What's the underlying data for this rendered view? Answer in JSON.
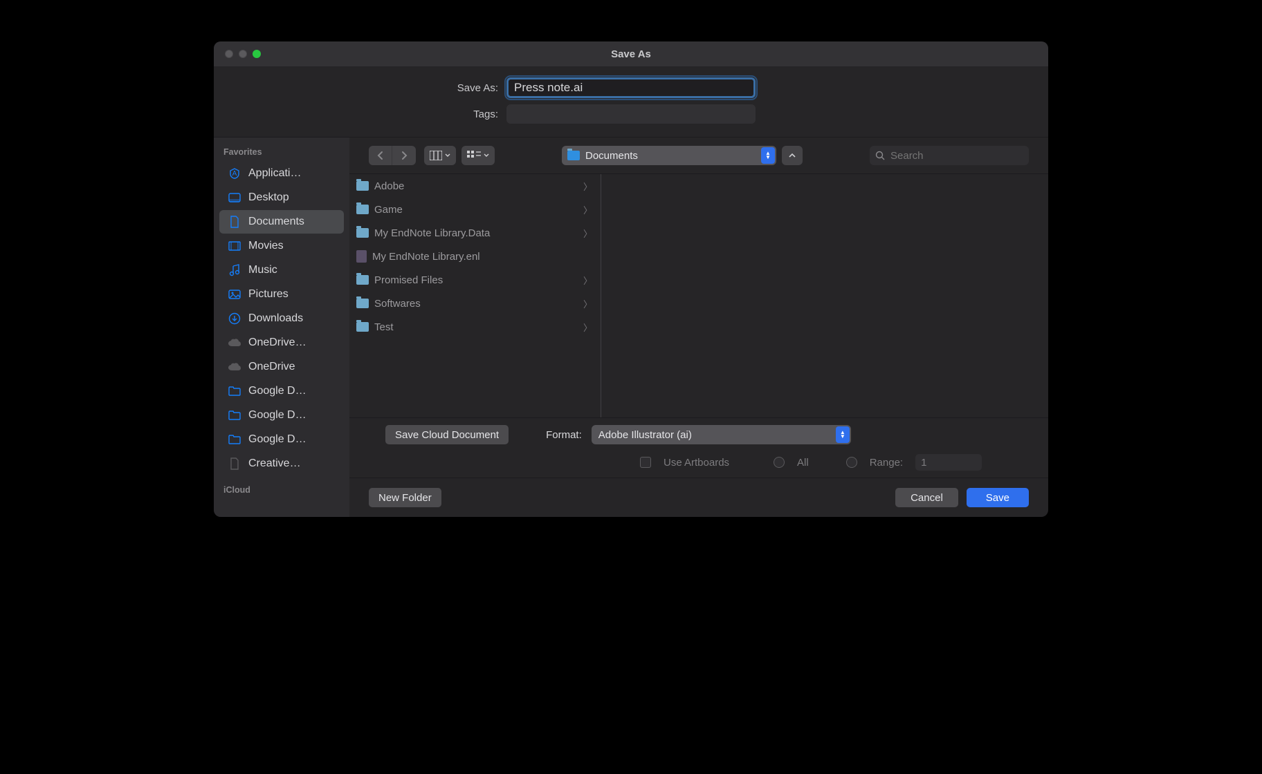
{
  "window": {
    "title": "Save As"
  },
  "form": {
    "saveas_label": "Save As:",
    "saveas_value": "Press note.ai",
    "tags_label": "Tags:",
    "tags_value": ""
  },
  "location": {
    "folder_label": "Documents"
  },
  "search": {
    "placeholder": "Search"
  },
  "sidebar": {
    "sections": [
      {
        "title": "Favorites",
        "items": [
          {
            "icon": "app",
            "label": "Applicati…"
          },
          {
            "icon": "desktop",
            "label": "Desktop"
          },
          {
            "icon": "doc",
            "label": "Documents",
            "selected": true
          },
          {
            "icon": "movies",
            "label": "Movies"
          },
          {
            "icon": "music",
            "label": "Music"
          },
          {
            "icon": "pictures",
            "label": "Pictures"
          },
          {
            "icon": "downloads",
            "label": "Downloads"
          },
          {
            "icon": "cloud-grey",
            "label": "OneDrive…"
          },
          {
            "icon": "cloud-grey",
            "label": "OneDrive"
          },
          {
            "icon": "folder",
            "label": "Google D…"
          },
          {
            "icon": "folder",
            "label": "Google D…"
          },
          {
            "icon": "folder",
            "label": "Google D…"
          },
          {
            "icon": "file-grey",
            "label": "Creative…"
          }
        ]
      },
      {
        "title": "iCloud",
        "items": []
      }
    ]
  },
  "column": {
    "items": [
      {
        "type": "folder",
        "name": "Adobe",
        "chevron": true
      },
      {
        "type": "folder",
        "name": "Game",
        "chevron": true
      },
      {
        "type": "folder",
        "name": "My EndNote Library.Data",
        "chevron": true
      },
      {
        "type": "file",
        "name": "My EndNote Library.enl",
        "chevron": false
      },
      {
        "type": "folder",
        "name": "Promised Files",
        "chevron": true
      },
      {
        "type": "folder",
        "name": "Softwares",
        "chevron": true
      },
      {
        "type": "folder",
        "name": "Test",
        "chevron": true
      }
    ]
  },
  "format": {
    "label": "Format:",
    "value": "Adobe Illustrator (ai)",
    "cloud_button": "Save Cloud Document",
    "use_artboards": "Use Artboards",
    "all": "All",
    "range_label": "Range:",
    "range_value": "1"
  },
  "actions": {
    "new_folder": "New Folder",
    "cancel": "Cancel",
    "save": "Save"
  }
}
